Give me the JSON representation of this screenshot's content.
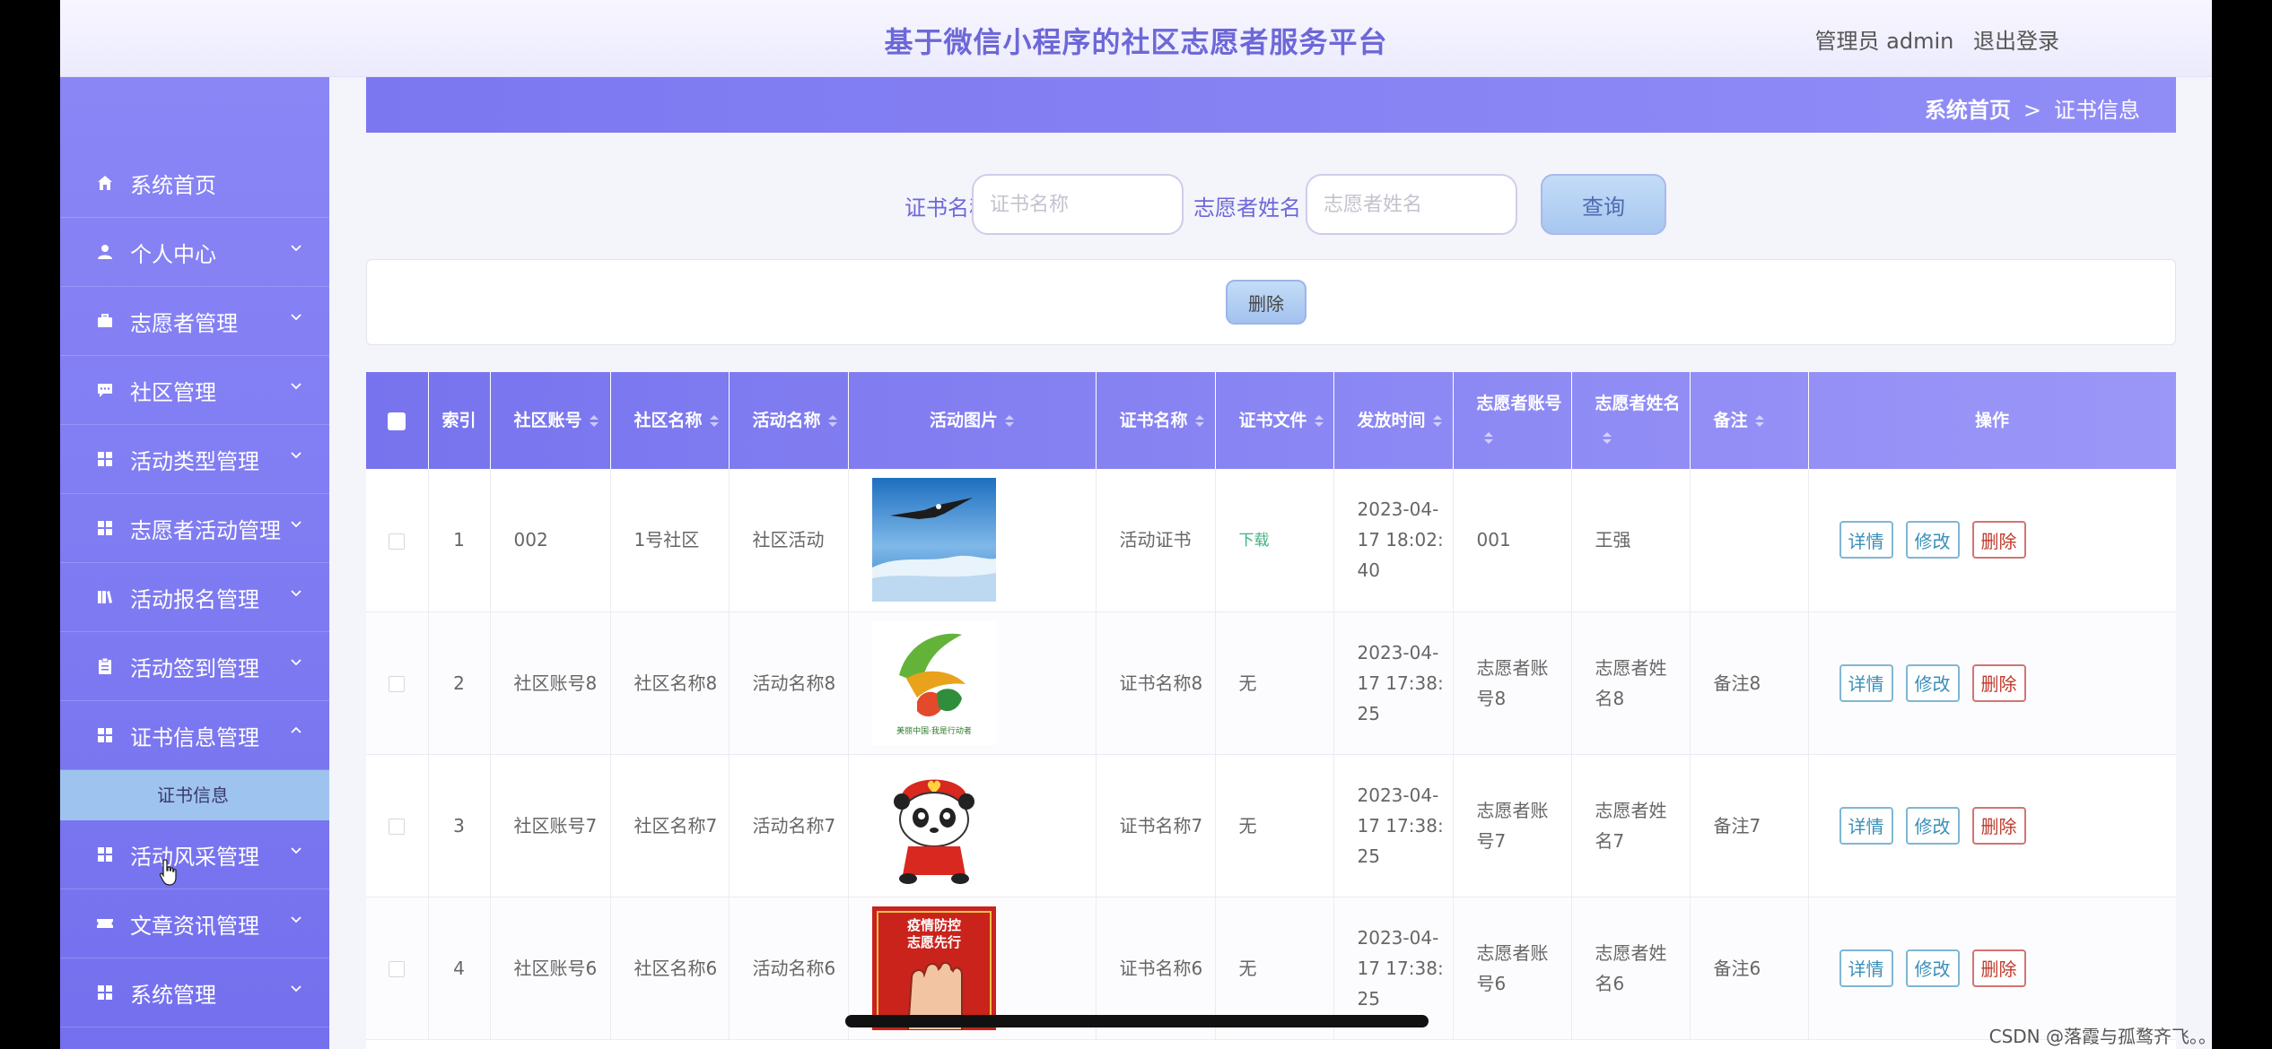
{
  "header": {
    "title": "基于微信小程序的社区志愿者服务平台",
    "user_role": "管理员 admin",
    "logout": "退出登录"
  },
  "sidebar": {
    "items": [
      {
        "label": "系统首页",
        "icon": "home-icon",
        "has_chevron": false
      },
      {
        "label": "个人中心",
        "icon": "user-icon",
        "has_chevron": true
      },
      {
        "label": "志愿者管理",
        "icon": "briefcase-icon",
        "has_chevron": true
      },
      {
        "label": "社区管理",
        "icon": "chat-icon",
        "has_chevron": true
      },
      {
        "label": "活动类型管理",
        "icon": "grid-icon",
        "has_chevron": true
      },
      {
        "label": "志愿者活动管理",
        "icon": "grid-icon",
        "has_chevron": true
      },
      {
        "label": "活动报名管理",
        "icon": "book-icon",
        "has_chevron": true
      },
      {
        "label": "活动签到管理",
        "icon": "clipboard-icon",
        "has_chevron": true
      },
      {
        "label": "证书信息管理",
        "icon": "grid-icon",
        "has_chevron": true,
        "expanded": true
      },
      {
        "label": "活动风采管理",
        "icon": "grid-icon",
        "has_chevron": true
      },
      {
        "label": "文章资讯管理",
        "icon": "ticket-icon",
        "has_chevron": true
      },
      {
        "label": "系统管理",
        "icon": "grid-icon",
        "has_chevron": true
      }
    ],
    "active_subitem": "证书信息"
  },
  "breadcrumb": {
    "home": "系统首页",
    "separator": ">",
    "current": "证书信息"
  },
  "search": {
    "cert_name_label": "证书名称",
    "cert_name_placeholder": "证书名称",
    "cert_name_value": "",
    "volunteer_name_label": "志愿者姓名",
    "volunteer_name_placeholder": "志愿者姓名",
    "volunteer_name_value": "",
    "query_button": "查询"
  },
  "actions": {
    "delete_button": "删除"
  },
  "table": {
    "columns": [
      "",
      "索引",
      "社区账号",
      "社区名称",
      "活动名称",
      "活动图片",
      "证书名称",
      "证书文件",
      "发放时间",
      "志愿者账号",
      "志愿者姓名",
      "备注",
      "操作"
    ],
    "rows": [
      {
        "index": "1",
        "community_account": "002",
        "community_name": "1号社区",
        "activity_name": "社区活动",
        "image": "eagle-image",
        "cert_name": "活动证书",
        "cert_file": "下载",
        "issue_time": "2023-04-17 18:02:40",
        "volunteer_account": "001",
        "volunteer_name": "王强",
        "remark": ""
      },
      {
        "index": "2",
        "community_account": "社区账号8",
        "community_name": "社区名称8",
        "activity_name": "活动名称8",
        "image": "volunteer-logo-image",
        "cert_name": "证书名称8",
        "cert_file": "无",
        "issue_time": "2023-04-17 17:38:25",
        "volunteer_account": "志愿者账号8",
        "volunteer_name": "志愿者姓名8",
        "remark": "备注8"
      },
      {
        "index": "3",
        "community_account": "社区账号7",
        "community_name": "社区名称7",
        "activity_name": "活动名称7",
        "image": "panda-mascot-image",
        "cert_name": "证书名称7",
        "cert_file": "无",
        "issue_time": "2023-04-17 17:38:25",
        "volunteer_account": "志愿者账号7",
        "volunteer_name": "志愿者姓名7",
        "remark": "备注7"
      },
      {
        "index": "4",
        "community_account": "社区账号6",
        "community_name": "社区名称6",
        "activity_name": "活动名称6",
        "image": "epidemic-poster-image",
        "cert_name": "证书名称6",
        "cert_file": "无",
        "issue_time": "2023-04-17 17:38:25",
        "volunteer_account": "志愿者账号6",
        "volunteer_name": "志愿者姓名6",
        "remark": "备注6"
      }
    ],
    "row_actions": {
      "detail": "详情",
      "edit": "修改",
      "delete": "删除"
    },
    "poster_text_line1": "疫情防控",
    "poster_text_line2": "志愿先行",
    "logo_caption": "美丽中国·我是行动者"
  },
  "watermark": "CSDN @落霞与孤鹜齐飞。。",
  "colors": {
    "accent": "#7b77f0",
    "title": "#6d68d8",
    "link_green": "#3db37f",
    "danger": "#c0392b"
  }
}
